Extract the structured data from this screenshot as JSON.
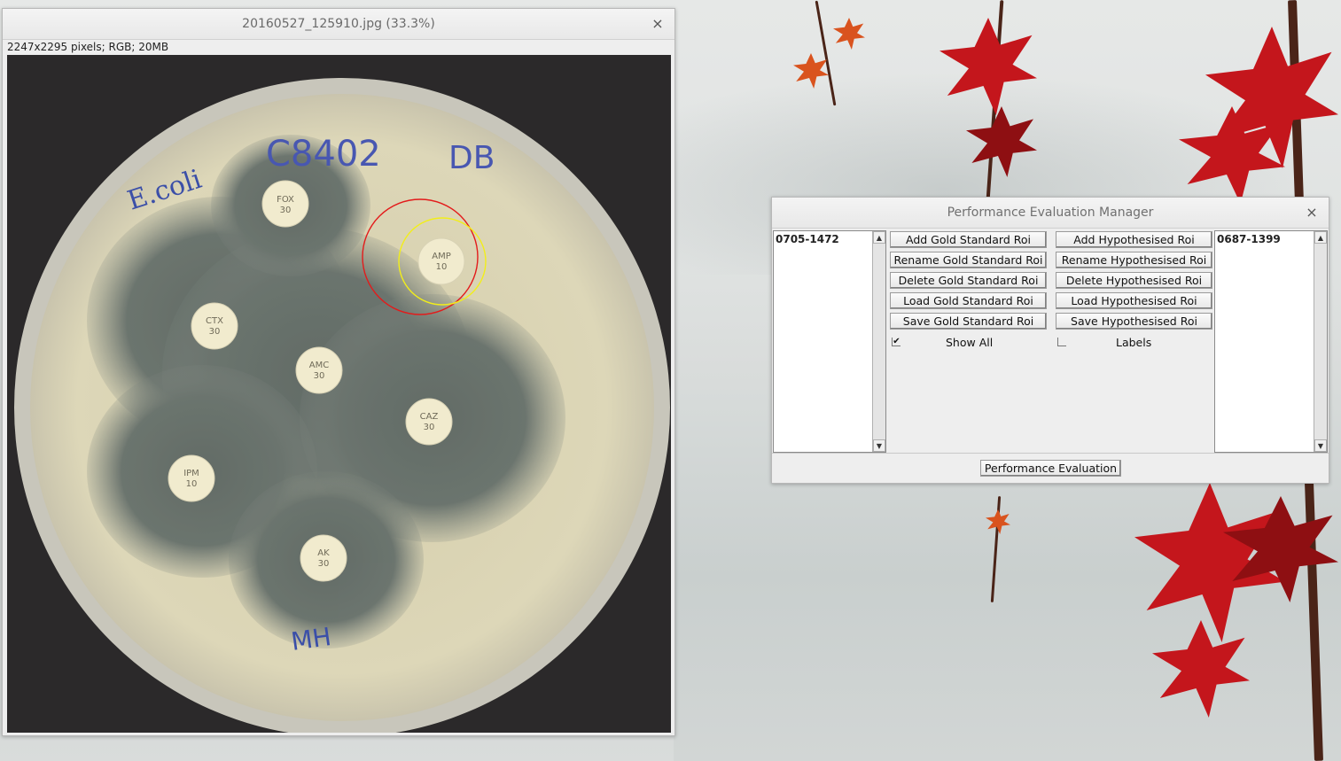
{
  "image_window": {
    "title": "20160527_125910.jpg (33.3%)",
    "info": "2247x2295 pixels; RGB; 20MB",
    "close_symbol": "×",
    "plate_labels": {
      "organism": "E.coli",
      "sample_id": "C8402",
      "initials": "DB",
      "bottom_mark": "MH"
    },
    "disks": [
      {
        "code": "FOX",
        "dose": "30"
      },
      {
        "code": "AMP",
        "dose": "10"
      },
      {
        "code": "CTX",
        "dose": "30"
      },
      {
        "code": "AMC",
        "dose": "30"
      },
      {
        "code": "CAZ",
        "dose": "30"
      },
      {
        "code": "IPM",
        "dose": "10"
      },
      {
        "code": "AK",
        "dose": "30"
      }
    ],
    "overlay_colors": {
      "gold_roi": "#e31b1b",
      "hypothesised_roi": "#f2ee1a"
    }
  },
  "perf_window": {
    "title": "Performance Evaluation Manager",
    "close_symbol": "×",
    "gold_list": [
      "0705-1472"
    ],
    "hypothesised_list": [
      "0687-1399"
    ],
    "gold_buttons": {
      "add": "Add Gold Standard Roi",
      "rename": "Rename Gold Standard Roi",
      "delete": "Delete Gold Standard Roi",
      "load": "Load Gold Standard Roi",
      "save": "Save Gold Standard Roi"
    },
    "hyp_buttons": {
      "add": "Add Hypothesised Roi",
      "rename": "Rename Hypothesised Roi",
      "delete": "Delete Hypothesised Roi",
      "load": "Load Hypothesised Roi",
      "save": "Save Hypothesised Roi"
    },
    "show_all": {
      "label": "Show All",
      "checked": true,
      "mark": "✔"
    },
    "labels": {
      "label": "Labels",
      "checked": false
    },
    "evaluate_button": "Performance Evaluation",
    "scroll_up": "▲",
    "scroll_down": "▼"
  }
}
